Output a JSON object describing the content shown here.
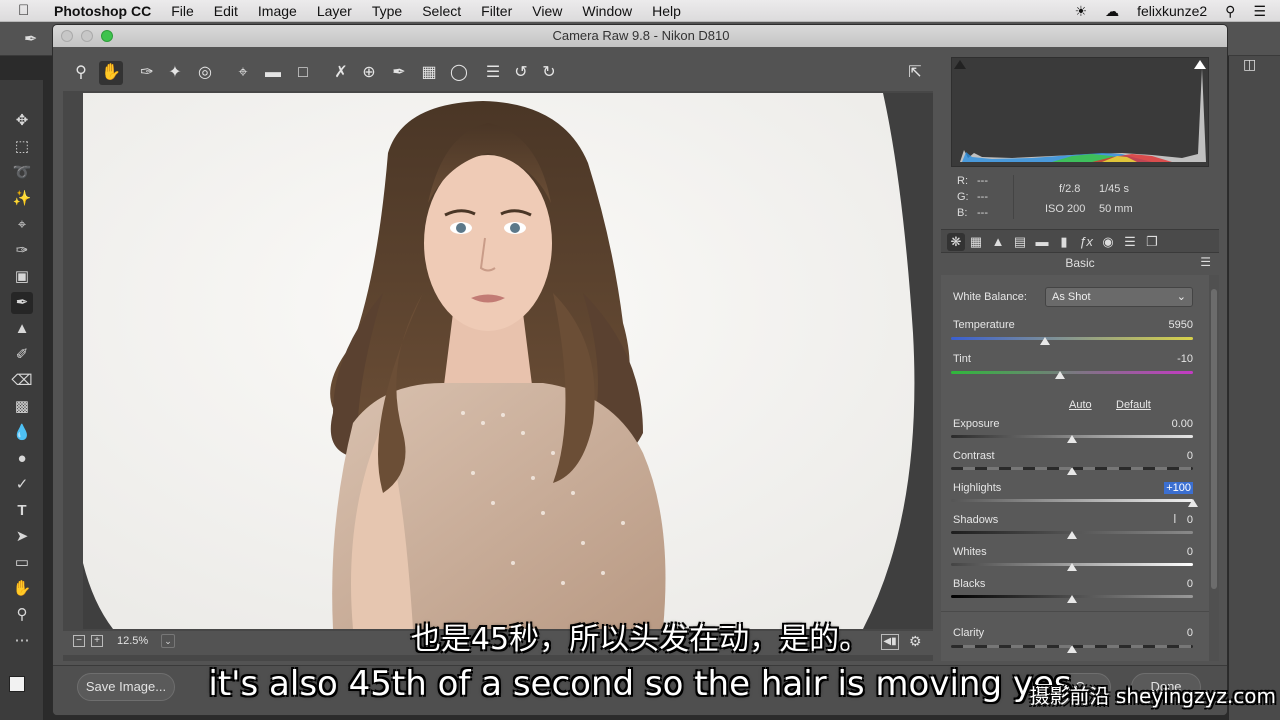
{
  "menubar": {
    "app_name": "Photoshop CC",
    "items": [
      "File",
      "Edit",
      "Image",
      "Layer",
      "Type",
      "Select",
      "Filter",
      "View",
      "Window",
      "Help"
    ],
    "user": "felixkunze2"
  },
  "dialog": {
    "title": "Camera Raw 9.8  -  Nikon D810"
  },
  "preview": {
    "zoom": "12.5%"
  },
  "readout": {
    "r_label": "R:",
    "r_val": "---",
    "g_label": "G:",
    "g_val": "---",
    "b_label": "B:",
    "b_val": "---",
    "aperture": "f/2.8",
    "shutter": "1/45 s",
    "iso": "ISO 200",
    "focal": "50 mm"
  },
  "panel": {
    "section_title": "Basic",
    "white_balance_label": "White Balance:",
    "white_balance_value": "As Shot",
    "auto": "Auto",
    "default": "Default",
    "sliders": [
      {
        "label": "Temperature",
        "value": "5950",
        "position": 0.39
      },
      {
        "label": "Tint",
        "value": "-10",
        "position": 0.45
      },
      {
        "label": "Exposure",
        "value": "0.00",
        "position": 0.5
      },
      {
        "label": "Contrast",
        "value": "0",
        "position": 0.5
      },
      {
        "label": "Highlights",
        "value": "+100",
        "position": 1.0
      },
      {
        "label": "Shadows",
        "value": "0",
        "position": 0.5
      },
      {
        "label": "Whites",
        "value": "0",
        "position": 0.5
      },
      {
        "label": "Blacks",
        "value": "0",
        "position": 0.5
      },
      {
        "label": "Clarity",
        "value": "0",
        "position": 0.5
      }
    ]
  },
  "bottom": {
    "save_label": "Save Image...",
    "cancel_label": "C",
    "done_label": "Done"
  },
  "subtitles": {
    "chinese": "也是45秒，所以头发在动，是的。",
    "english": "it's also 45th of a second so the hair is moving yes"
  },
  "watermark": "摄影前沿 sheyingzyz.com",
  "colors": {
    "highlight_value_bg": "#3b6fd1"
  }
}
